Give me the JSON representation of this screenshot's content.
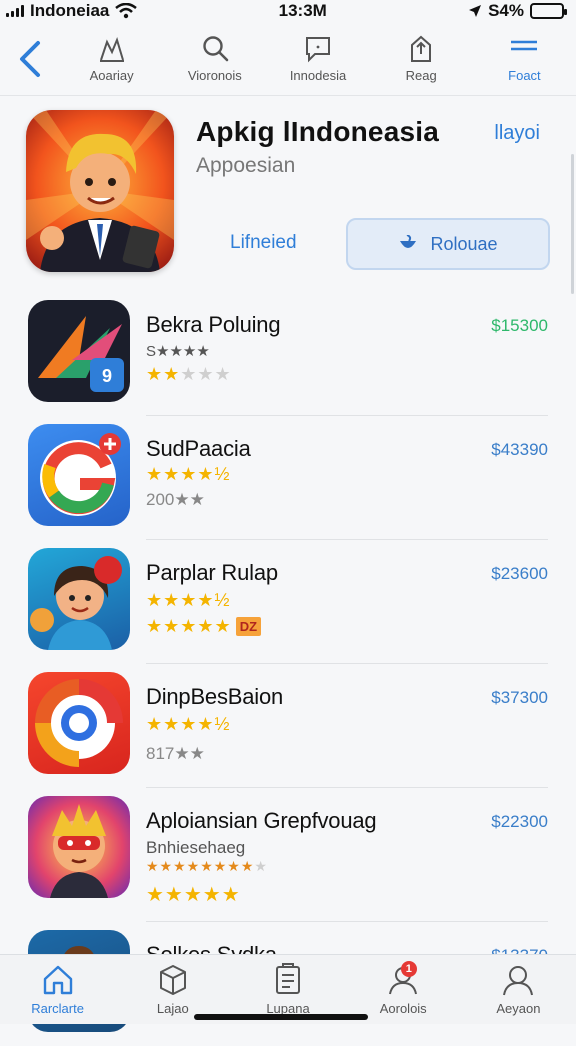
{
  "status": {
    "carrier": "Indoneiaa",
    "time": "13:3M",
    "battery": "S4%",
    "battery_level": 0.94
  },
  "topnav": {
    "items": [
      {
        "label": "Aoariay",
        "icon": "activity-icon"
      },
      {
        "label": "Vioronois",
        "icon": "search-icon"
      },
      {
        "label": "Innodesia",
        "icon": "message-icon"
      },
      {
        "label": "Reag",
        "icon": "share-icon"
      },
      {
        "label": "Foact",
        "icon": "menu-icon"
      }
    ]
  },
  "hero": {
    "title": "Apkig lIndoneasia",
    "link": "llayoi",
    "subtitle": "Appoesian",
    "secondary_button": "Lifneied",
    "primary_button": "Rolouae"
  },
  "apps": [
    {
      "name": "Bekra Poluing",
      "price": "$15300",
      "line2": "S★★★★",
      "rating": 2,
      "icon": "arrow-logo-icon"
    },
    {
      "name": "SudPaacia",
      "price": "$43390",
      "rating": 4.5,
      "line3": "200★★",
      "icon": "g-logo-icon"
    },
    {
      "name": "Parplar Rulap",
      "price": "$23600",
      "rating": 4.5,
      "rating2": 5,
      "tag": "DZ",
      "icon": "girl-character-icon"
    },
    {
      "name": "DinpBesBaion",
      "price": "$37300",
      "rating": 4.5,
      "line3": "817★★",
      "icon": "circle-logo-icon"
    },
    {
      "name": "Aploiansian Grepfvouag",
      "price": "$22300",
      "line2": "Bnhiesehaeg",
      "rating_small": 8,
      "rating": 5,
      "icon": "masked-hero-icon"
    },
    {
      "name": "Solkes Sydka",
      "price": "$13370",
      "icon": "warrior-character-icon"
    }
  ],
  "tabbar": {
    "items": [
      {
        "label": "Rarclarte",
        "icon": "home-icon"
      },
      {
        "label": "Lajao",
        "icon": "box-icon"
      },
      {
        "label": "Lupana",
        "icon": "document-icon"
      },
      {
        "label": "Aorolois",
        "icon": "person-icon",
        "badge": "1"
      },
      {
        "label": "Aeyaon",
        "icon": "profile-icon"
      }
    ]
  },
  "colors": {
    "accent": "#2f7ed8",
    "price_green": "#2eb86b",
    "star": "#f4b400"
  }
}
